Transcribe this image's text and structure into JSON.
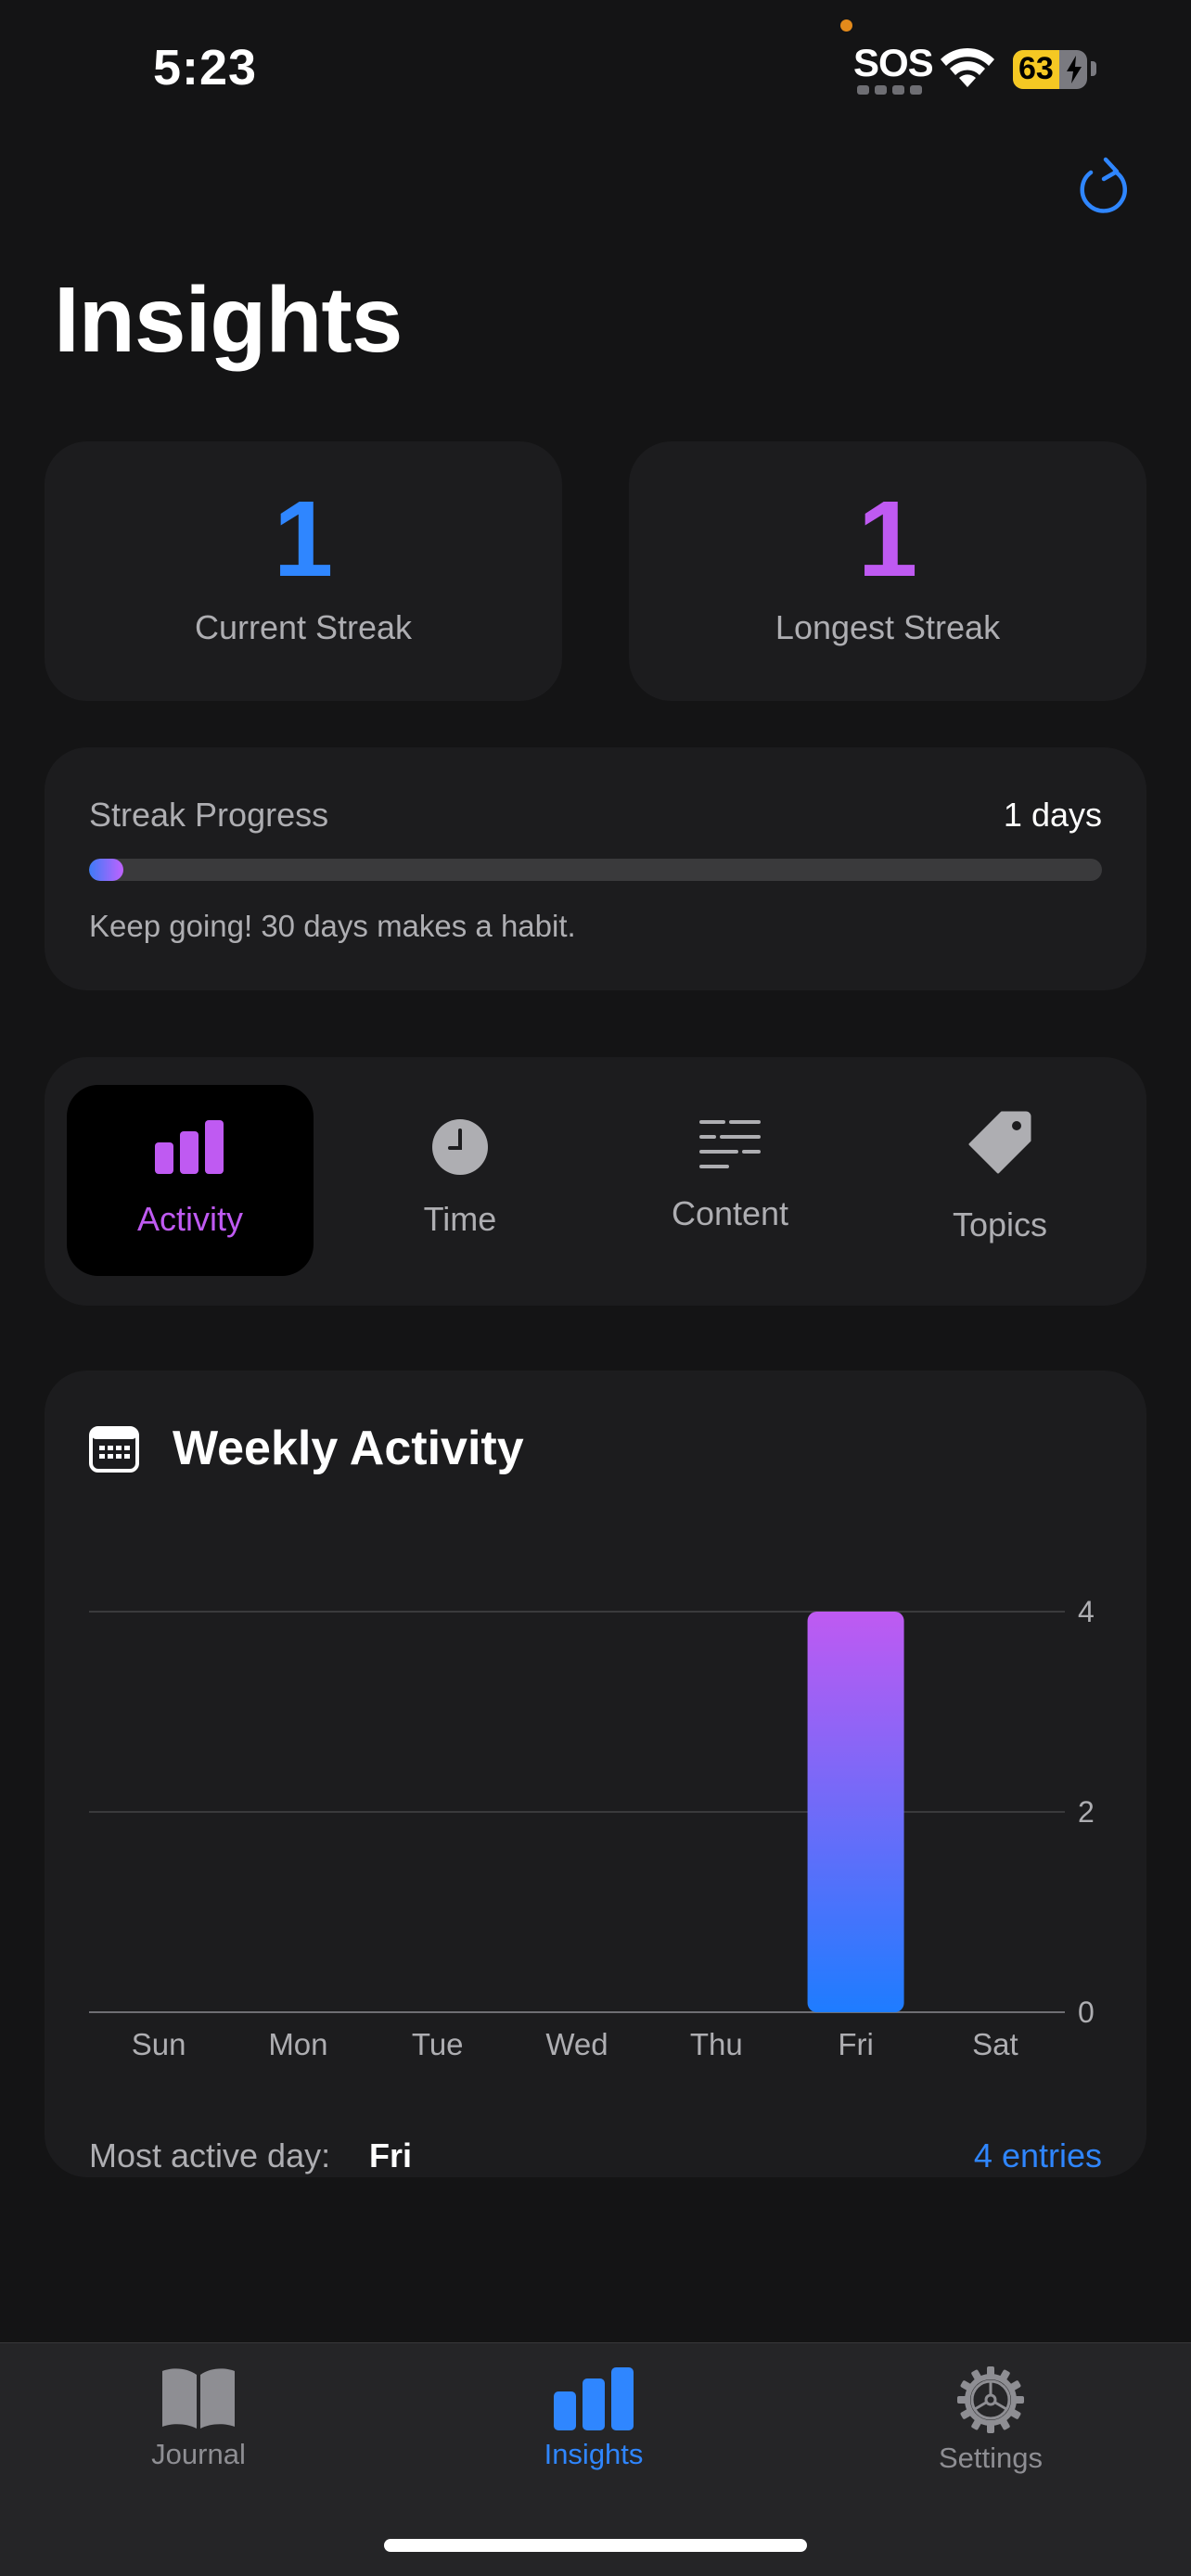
{
  "status_bar": {
    "time": "5:23",
    "sos": "SOS",
    "battery_level": "63",
    "battery_percent": 63
  },
  "header": {
    "title": "Insights",
    "refresh_icon": "arrow-clockwise-icon"
  },
  "stats": {
    "current_streak": {
      "value": "1",
      "label": "Current Streak",
      "color": "#2f86ff"
    },
    "longest_streak": {
      "value": "1",
      "label": "Longest Streak",
      "color": "#bf5af2"
    }
  },
  "streak_progress": {
    "label": "Streak Progress",
    "days_text": "1 days",
    "progress_fraction": 0.0333,
    "hint": "Keep going! 30 days makes a habit."
  },
  "segments": [
    {
      "label": "Activity",
      "icon": "bar-chart-icon",
      "active": true
    },
    {
      "label": "Time",
      "icon": "clock-icon",
      "active": false
    },
    {
      "label": "Content",
      "icon": "text-lines-icon",
      "active": false
    },
    {
      "label": "Topics",
      "icon": "tag-icon",
      "active": false
    }
  ],
  "weekly_activity": {
    "title": "Weekly Activity",
    "icon": "calendar-icon",
    "most_active_label": "Most active day:",
    "most_active_day": "Fri",
    "entries_text": "4 entries"
  },
  "chart_data": {
    "type": "bar",
    "categories": [
      "Sun",
      "Mon",
      "Tue",
      "Wed",
      "Thu",
      "Fri",
      "Sat"
    ],
    "values": [
      0,
      0,
      0,
      0,
      0,
      4,
      0
    ],
    "yticks": [
      "0",
      "2",
      "4"
    ],
    "ylim": [
      0,
      4
    ],
    "grid": true,
    "bar_gradient": [
      "#bf5af2",
      "#1e7cff"
    ]
  },
  "tabbar": [
    {
      "label": "Journal",
      "icon": "book-icon",
      "active": false
    },
    {
      "label": "Insights",
      "icon": "bar-chart-icon",
      "active": true
    },
    {
      "label": "Settings",
      "icon": "gear-icon",
      "active": false
    }
  ],
  "colors": {
    "accent_blue": "#2f86ff",
    "accent_purple": "#bf5af2",
    "background": "#141415",
    "card": "#1c1c1e"
  }
}
